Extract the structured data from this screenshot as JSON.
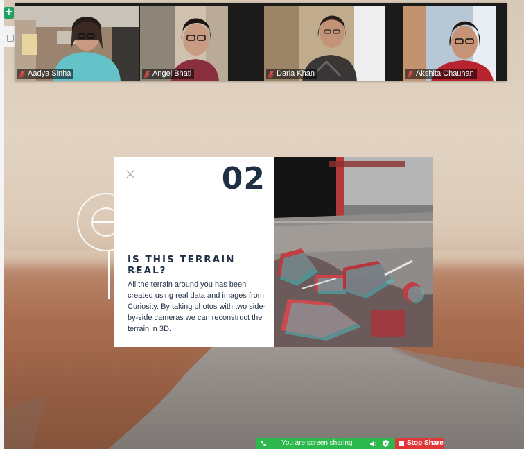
{
  "app": {
    "sheets_icon": "sheets-plus-icon"
  },
  "participants": [
    {
      "name": "Aadya Sinha",
      "mic": "mic-muted-icon"
    },
    {
      "name": "Angel Bhati",
      "mic": "mic-muted-icon"
    },
    {
      "name": "Daria Khan",
      "mic": "mic-muted-icon"
    },
    {
      "name": "Akshita Chauhan",
      "mic": "mic-muted-icon"
    }
  ],
  "card": {
    "close_glyph": "×",
    "number": "02",
    "title": "IS THIS TERRAIN REAL?",
    "body": "All the terrain around you has been created using real data and images from Curiosity. By taking photos with two side-by-side cameras we can reconstruct the terrain in 3D."
  },
  "share_bar": {
    "status": "You are screen sharing",
    "stop_label": "Stop Share",
    "colors": {
      "green": "#2db84d",
      "red": "#e0373b"
    }
  },
  "colors": {
    "navy": "#1f2f44",
    "mars_sky": "#dccab7",
    "mars_ground": "#a86c4f"
  }
}
